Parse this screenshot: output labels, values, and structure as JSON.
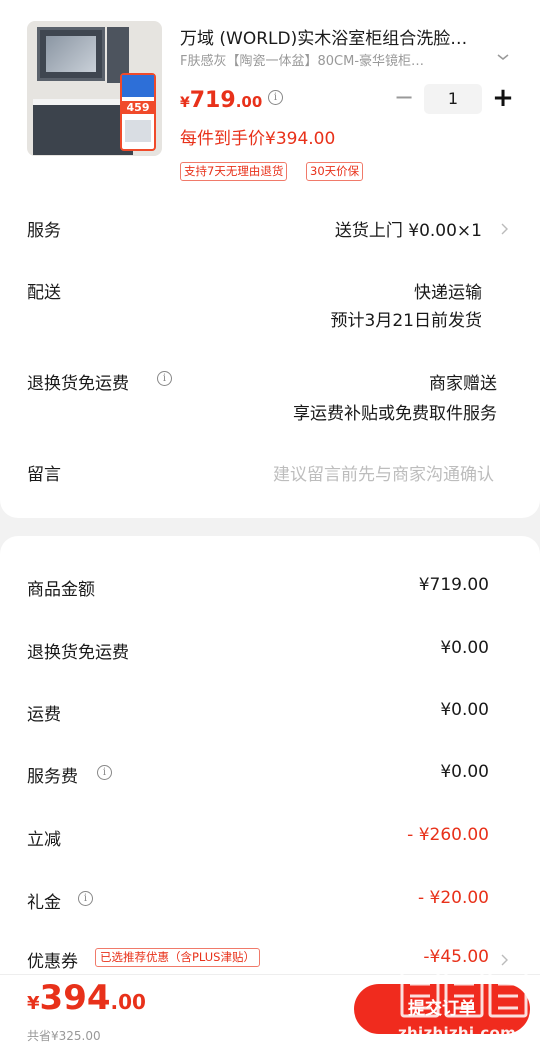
{
  "product": {
    "title": "万域 (WORLD)实木浴室柜组合洗脸…",
    "spec": "F肤感灰【陶瓷一体盆】80CM-豪华镜柜…",
    "price_symbol": "¥",
    "price_int": "719",
    "price_dec": ".00",
    "quantity": "1",
    "deal_price": "每件到手价¥394.00",
    "tags": [
      "支持7天无理由退货",
      "30天价保"
    ],
    "image_badge": "459",
    "icons": {
      "spec": "chevron-down-icon",
      "price_info": "info-icon",
      "minus": "minus-icon",
      "plus": "plus-icon"
    }
  },
  "order_rows": {
    "service": {
      "label": "服务",
      "value": "送货上门  ¥0.00×1"
    },
    "delivery": {
      "label": "配送",
      "value_line1": "快递运输",
      "value_line2": "预计3月21日前发货"
    },
    "return_shipping": {
      "label": "退换货免运费",
      "value_line1": "商家赠送",
      "value_line2": "享运费补贴或免费取件服务"
    },
    "message": {
      "label": "留言",
      "placeholder": "建议留言前先与商家沟通确认"
    }
  },
  "amounts": {
    "goods": {
      "label": "商品金额",
      "value": "¥719.00"
    },
    "return_fee": {
      "label": "退换货免运费",
      "value": "¥0.00"
    },
    "shipping": {
      "label": "运费",
      "value": "¥0.00"
    },
    "service_fee": {
      "label": "服务费",
      "value": "¥0.00"
    },
    "instant_discount": {
      "label": "立减",
      "value": "- ¥260.00"
    },
    "gift_money": {
      "label": "礼金",
      "value": "- ¥20.00"
    },
    "coupon": {
      "label": "优惠券",
      "tag": "已选推荐优惠（含PLUS津贴）",
      "value": "-¥45.00"
    }
  },
  "footer": {
    "total_symbol": "¥",
    "total_int": "394",
    "total_dec": ".00",
    "saved": "共省¥325.00",
    "submit_label": "提交订单",
    "watermark_site": "zhizhizhi.com",
    "watermark_logo": "值值值"
  },
  "colors": {
    "accent": "#e8311a",
    "button": "#f02b1e",
    "muted": "#999999",
    "placeholder": "#bdbdbd"
  }
}
